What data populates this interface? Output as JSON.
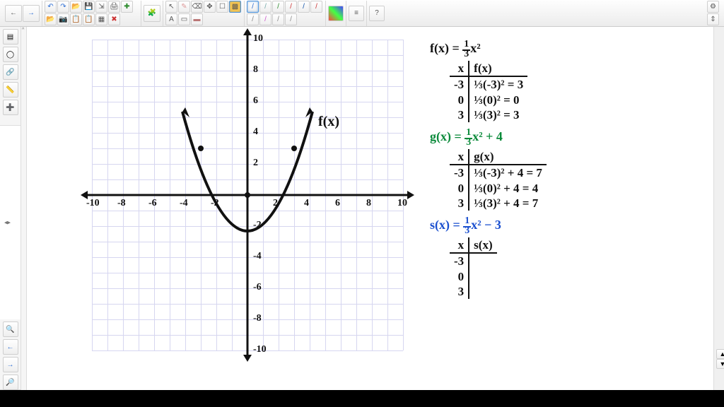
{
  "chart_data": {
    "type": "line",
    "title": "",
    "xlabel": "",
    "ylabel": "",
    "xlim": [
      -10,
      10
    ],
    "ylim": [
      -10,
      10
    ],
    "x_ticks": [
      -10,
      -8,
      -6,
      -4,
      -2,
      2,
      4,
      6,
      8,
      10
    ],
    "y_ticks": [
      -10,
      -8,
      -6,
      -4,
      -2,
      2,
      4,
      6,
      8,
      10
    ],
    "series": [
      {
        "name": "f(x)",
        "x": [
          -4,
          -3,
          -2,
          -1,
          0,
          1,
          2,
          3,
          4
        ],
        "values": [
          5.33,
          3,
          1.33,
          0.33,
          0,
          0.33,
          1.33,
          3,
          5.33
        ]
      }
    ],
    "marked_points": [
      {
        "x": -3,
        "y": 3
      },
      {
        "x": 0,
        "y": 0
      },
      {
        "x": 3,
        "y": 3
      }
    ]
  },
  "functions": {
    "f": {
      "name": "f(x)",
      "expr_parts": [
        "f(x) = ",
        "1",
        "3",
        "x²"
      ],
      "table_header": [
        "x",
        "f(x)"
      ],
      "rows": [
        {
          "x": "-3",
          "calc": "⅓(-3)² = 3"
        },
        {
          "x": "0",
          "calc": "⅓(0)² = 0"
        },
        {
          "x": "3",
          "calc": "⅓(3)² = 3"
        }
      ]
    },
    "g": {
      "name": "g(x)",
      "expr_parts": [
        "g(x) = ",
        "1",
        "3",
        "x² + 4"
      ],
      "table_header": [
        "x",
        "g(x)"
      ],
      "rows": [
        {
          "x": "-3",
          "calc": "⅓(-3)² + 4 = 7"
        },
        {
          "x": "0",
          "calc": "⅓(0)² + 4 = 4"
        },
        {
          "x": "3",
          "calc": "⅓(3)² + 4 = 7"
        }
      ]
    },
    "s": {
      "name": "s(x)",
      "expr_parts": [
        "s(x) = ",
        "1",
        "3",
        "x² − 3"
      ],
      "table_header": [
        "x",
        "s(x)"
      ],
      "rows": [
        {
          "x": "-3",
          "calc": ""
        },
        {
          "x": "0",
          "calc": ""
        },
        {
          "x": "3",
          "calc": ""
        }
      ]
    }
  },
  "axis_labels": {
    "x_neg": [
      "-10",
      "-8",
      "-6",
      "-4",
      "-2"
    ],
    "x_pos": [
      "2",
      "4",
      "6",
      "8",
      "10"
    ],
    "y_pos": [
      "2",
      "4",
      "6",
      "8",
      "10"
    ],
    "y_neg": [
      "-2",
      "-4",
      "-6",
      "-8",
      "-10"
    ]
  },
  "toolbar": {
    "nav_back": "←",
    "nav_forward": "→",
    "undo": "↶",
    "redo": "↷",
    "file_open": "📂",
    "save": "💾",
    "export": "⇲",
    "print": "🖨",
    "new": "✚",
    "screenshot": "📷",
    "copy": "📋",
    "paste": "📋",
    "table": "▦",
    "delete": "✖",
    "plugin": "🧩",
    "pointer": "↖",
    "pen": "✎",
    "eraser": "⌫",
    "move": "✥",
    "select": "☐",
    "fill": "▩",
    "text": "A",
    "marquee": "▭",
    "highlighter": "▬",
    "stroke1": "/",
    "stroke2": "/",
    "stroke3": "/",
    "stroke4": "/",
    "stroke5": "/",
    "stroke6": "/",
    "stroke7": "/",
    "stroke8": "/",
    "stroke9": "/",
    "stroke10": "/",
    "color_picker": "▦",
    "align": "≡",
    "help": "?",
    "settings": "⚙",
    "expand": "⇕"
  },
  "sidebar": {
    "layers": "▤",
    "shapes": "◯",
    "link": "🔗",
    "ruler": "📏",
    "add": "➕",
    "zoom_in": "🔍",
    "prev": "←",
    "next": "→",
    "zoom_out": "🔎"
  }
}
